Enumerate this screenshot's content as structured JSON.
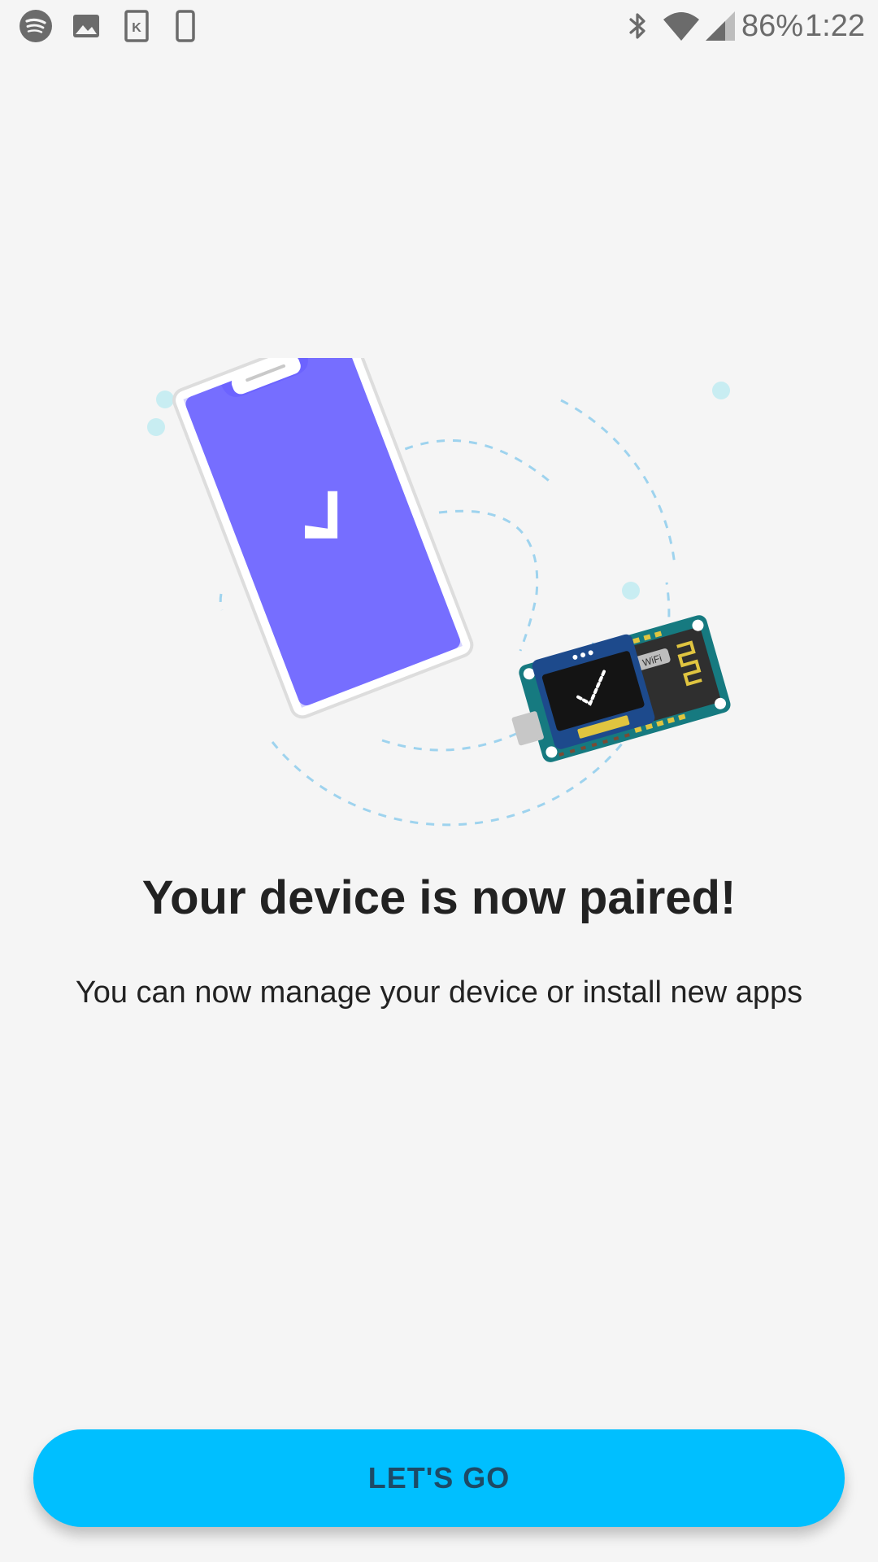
{
  "status_bar": {
    "icons_left": [
      "spotify-icon",
      "image-icon",
      "k-app-icon",
      "phone-icon"
    ],
    "icons_right": [
      "bluetooth-icon",
      "wifi-icon",
      "cell-signal-icon"
    ],
    "battery": "86%",
    "time": "1:22"
  },
  "illustration": {
    "description_icons": [
      "phone-check-icon",
      "board-device-icon"
    ],
    "phone_color": "#6c63ff",
    "accent_color": "#00bfff"
  },
  "content": {
    "title": "Your device is now paired!",
    "subtitle": "You can now manage your device or install new apps"
  },
  "cta": {
    "label": "LET'S GO"
  }
}
